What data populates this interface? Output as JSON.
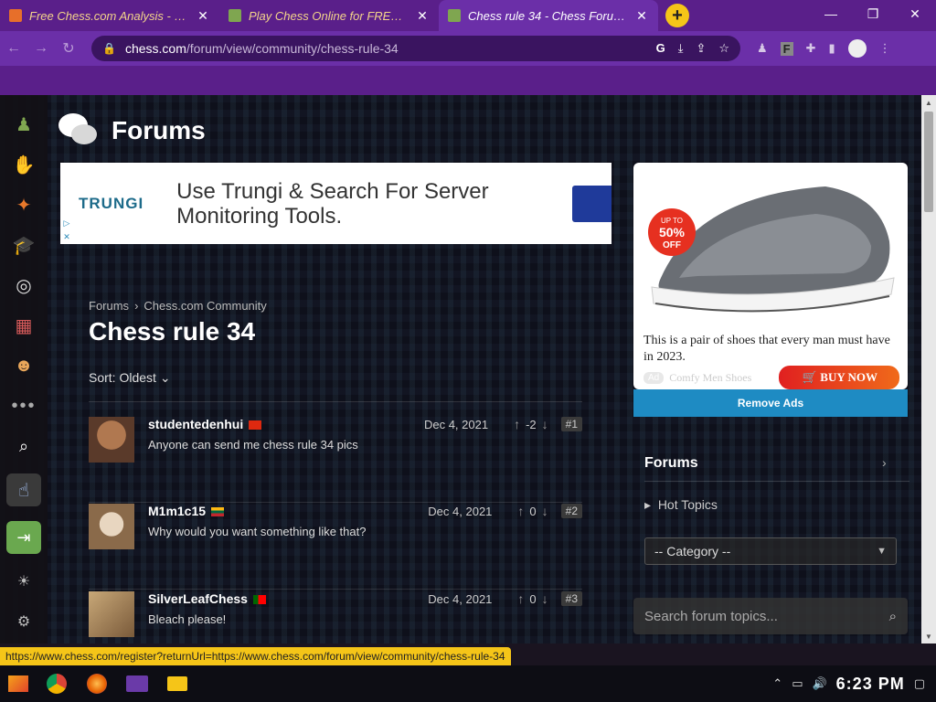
{
  "browser": {
    "tabs": [
      {
        "label": "Free Chess.com Analysis - Chr",
        "active": false
      },
      {
        "label": "Play Chess Online for FREE wi",
        "active": false
      },
      {
        "label": "Chess rule 34 - Chess Forums -",
        "active": true
      }
    ],
    "new_tab": "+",
    "url_host": "chess.com",
    "url_path": "/forum/view/community/chess-rule-34"
  },
  "page": {
    "section_title": "Forums",
    "top_ad": {
      "brand": "TRUNGI",
      "copy": "Use Trungi & Search For Server Monitoring Tools."
    },
    "breadcrumb": [
      "Forums",
      "Chess.com Community"
    ],
    "thread_title": "Chess rule 34",
    "sort_label": "Sort: Oldest",
    "posts": [
      {
        "username": "studentedenhui",
        "text": "Anyone can send me chess rule 34 pics",
        "date": "Dec 4, 2021",
        "votes": "-2",
        "number": "#1"
      },
      {
        "username": "M1m1c15",
        "text": "Why would you want something like that?",
        "date": "Dec 4, 2021",
        "votes": "0",
        "number": "#2"
      },
      {
        "username": "SilverLeafChess",
        "text": "Bleach please!",
        "date": "Dec 4, 2021",
        "votes": "0",
        "number": "#3"
      }
    ]
  },
  "sidebar": {
    "ad": {
      "badge_line1": "UP TO",
      "badge_line2": "50%",
      "badge_line3": "OFF",
      "copy": "This is a pair of shoes that every man must have in 2023.",
      "ad_label": "Ad",
      "advertiser": "Comfy Men Shoes",
      "cta": "BUY NOW"
    },
    "remove_ads": "Remove Ads",
    "forums_title": "Forums",
    "hot_topics": "Hot Topics",
    "category_select": "-- Category --",
    "search_placeholder": "Search forum topics..."
  },
  "status_url": "https://www.chess.com/register?returnUrl=https://www.chess.com/forum/view/community/chess-rule-34",
  "taskbar": {
    "clock": "6:23 PM"
  },
  "colors": {
    "browser_purple": "#6b2fa8",
    "tab_bar": "#5a1f8a",
    "remove_ads_blue": "#1e8bc3",
    "status_yellow": "#f5c518",
    "login_green": "#6aa84f"
  }
}
